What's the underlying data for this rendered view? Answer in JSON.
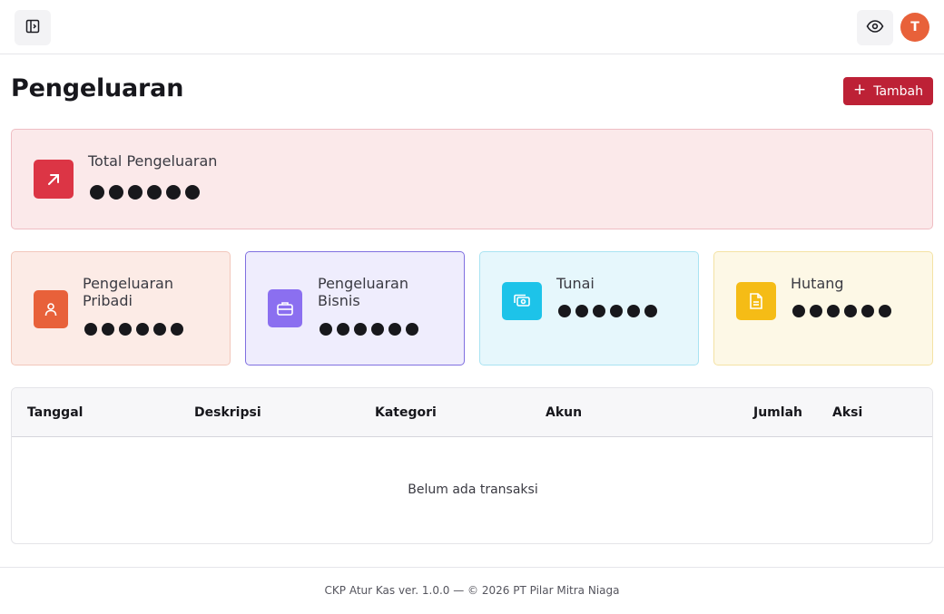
{
  "header": {
    "sidebar_toggle_icon": "sidebar-toggle-icon",
    "visibility_icon": "eye-icon",
    "avatar_initial": "T"
  },
  "page": {
    "title": "Pengeluaran",
    "add_button_label": "Tambah"
  },
  "summary": {
    "total": {
      "label": "Total Pengeluaran",
      "value_masked": "●●●●●●",
      "icon": "arrow-up-right-icon",
      "accent": "#dc3545"
    },
    "cards": [
      {
        "label": "Pengeluaran Pribadi",
        "value_masked": "●●●●●●",
        "icon": "user-icon",
        "accent": "#e8613a"
      },
      {
        "label": "Pengeluaran Bisnis",
        "value_masked": "●●●●●●",
        "icon": "briefcase-icon",
        "accent": "#8b6ff0"
      },
      {
        "label": "Tunai",
        "value_masked": "●●●●●●",
        "icon": "cash-icon",
        "accent": "#1dc3e9"
      },
      {
        "label": "Hutang",
        "value_masked": "●●●●●●",
        "icon": "document-icon",
        "accent": "#f5bc16"
      }
    ]
  },
  "table": {
    "columns": [
      "Tanggal",
      "Deskripsi",
      "Kategori",
      "Akun",
      "Jumlah",
      "Aksi"
    ],
    "rows": [],
    "empty_text": "Belum ada transaksi"
  },
  "footer": {
    "text": "CKP Atur Kas ver. 1.0.0 — © 2026 PT Pilar Mitra Niaga"
  }
}
